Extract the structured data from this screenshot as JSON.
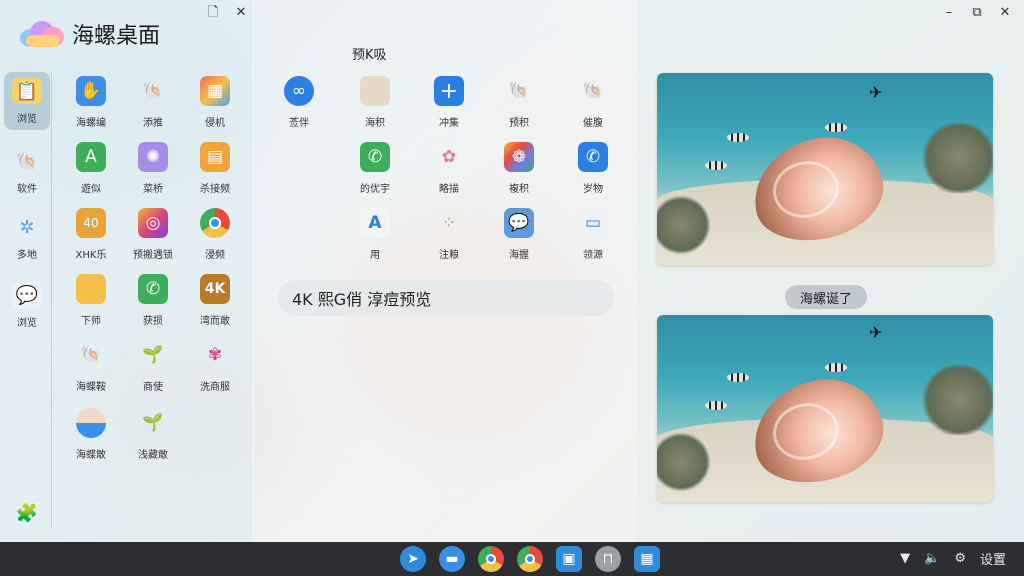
{
  "launcher": {
    "title": "海螺桌面",
    "controls": [
      "🗋",
      "✕"
    ],
    "categories": [
      {
        "label": "浏览",
        "icon": "notes-icon",
        "active": true
      },
      {
        "label": "软件",
        "icon": "shell-icon",
        "active": false
      },
      {
        "label": "多地",
        "icon": "gear-icon",
        "active": false
      },
      {
        "label": "浏览",
        "icon": "chat-icon",
        "active": false
      }
    ],
    "apps": [
      {
        "label": "海螺编",
        "icon": "hand-icon",
        "bg": "#3d8ee8"
      },
      {
        "label": "添推",
        "icon": "shell-icon",
        "bg": "#e9c5b4"
      },
      {
        "label": "侵机",
        "icon": "grid-icon",
        "bg": "#f0a84a"
      },
      {
        "label": "遊似",
        "icon": "contact-icon",
        "bg": "#3fae5c"
      },
      {
        "label": "菜桥",
        "icon": "sun-icon",
        "bg": "#a58ee8"
      },
      {
        "label": "杀接频",
        "icon": "note-icon",
        "bg": "#f2a33c"
      },
      {
        "label": "XHK乐",
        "icon": "calendar-icon",
        "bg": "#e9a43c"
      },
      {
        "label": "预搬遇锁",
        "icon": "camera-icon",
        "bg": "#d9467a"
      },
      {
        "label": "浸频",
        "icon": "chrome-icon",
        "bg": "#ffffff"
      },
      {
        "label": "下师",
        "icon": "folder-icon",
        "bg": "#f5c04a"
      },
      {
        "label": "获损",
        "icon": "phone-icon",
        "bg": "#3fae5c"
      },
      {
        "label": "湾而敢",
        "icon": "4k-icon",
        "bg": "#b97b28"
      },
      {
        "label": "海蝶鞍",
        "icon": "shell-icon",
        "bg": "#e9c5b4"
      },
      {
        "label": "商使",
        "icon": "plant-icon",
        "bg": "#e4e8ea"
      },
      {
        "label": "洗商服",
        "icon": "coral-icon",
        "bg": "#e4e8ea"
      },
      {
        "label": "海蝶敢",
        "icon": "shell-icon",
        "bg": "#3d8ee8"
      },
      {
        "label": "浅藏敢",
        "icon": "plant-icon",
        "bg": "#e4e8ea"
      }
    ],
    "bottom_icon": "puzzle-icon"
  },
  "center": {
    "section_title": "预K吸",
    "apps": [
      {
        "label": "莶伴",
        "icon": "link-icon",
        "bg": "#2b7fe0"
      },
      {
        "label": "海积",
        "icon": "folder-icon",
        "bg": "#e6d9c6"
      },
      {
        "label": "冲集",
        "icon": "plus-icon",
        "bg": "#2b7fe0"
      },
      {
        "label": "预积",
        "icon": "shell-icon",
        "bg": "#eedcd0"
      },
      {
        "label": "催腹",
        "icon": "shell-icon",
        "bg": "#eedcd0"
      },
      {
        "label": "的优宇",
        "icon": "phone-icon",
        "bg": "#3fae5c"
      },
      {
        "label": "略描",
        "icon": "bubbles-icon",
        "bg": "#e4e8ea"
      },
      {
        "label": "複积",
        "icon": "photos-icon",
        "bg": "#6a7ee8"
      },
      {
        "label": "岁物",
        "icon": "phone-icon",
        "bg": "#2b7fe0"
      },
      {
        "label": "用",
        "icon": "a-icon",
        "bg": "#e4e8ea"
      },
      {
        "label": "注粮",
        "icon": "nodes-icon",
        "bg": "#e4e8ea"
      },
      {
        "label": "海握",
        "icon": "message-icon",
        "bg": "#5f9ad8"
      },
      {
        "label": "领源",
        "icon": "card-icon",
        "bg": "#e4e8ea"
      }
    ],
    "preview_bar": "4K 熙G俏  淳痘预览"
  },
  "right": {
    "controls": [
      "–",
      "⧉",
      "✕"
    ],
    "apply_label": "海螺诞了"
  },
  "taskbar": {
    "dock": [
      {
        "icon": "pin-icon",
        "bg": "#2f8bdc"
      },
      {
        "icon": "chat-icon",
        "bg": "#3b8ee8"
      },
      {
        "icon": "chrome-icon",
        "bg": "#ffffff"
      },
      {
        "icon": "chrome-icon",
        "bg": "#ffffff"
      },
      {
        "icon": "store-icon",
        "bg": "#2f8bdc"
      },
      {
        "icon": "stool-icon",
        "bg": "#9aa0a6"
      },
      {
        "icon": "calc-icon",
        "bg": "#2f8bdc"
      }
    ],
    "tray_label": "设置"
  },
  "colors": {
    "accent": "#2b7fe0",
    "taskbar": "#2c2e31"
  }
}
